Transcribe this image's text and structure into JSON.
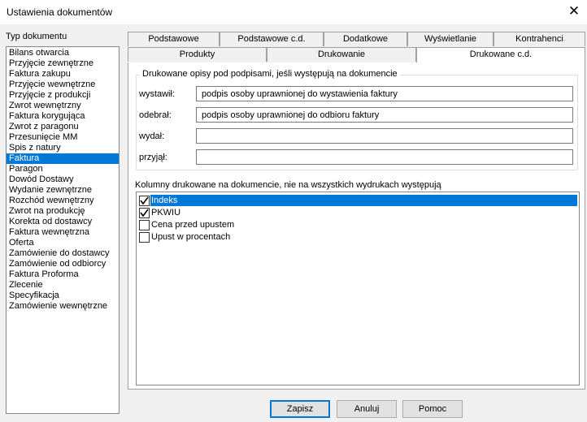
{
  "window": {
    "title": "Ustawienia dokumentów",
    "close_glyph": "✕"
  },
  "doc_types": {
    "label": "Typ dokumentu",
    "items": [
      "Bilans otwarcia",
      "Przyjęcie zewnętrzne",
      "Faktura zakupu",
      "Przyjęcie wewnętrzne",
      "Przyjęcie z produkcji",
      "Zwrot wewnętrzny",
      "Faktura korygująca",
      "Zwrot z paragonu",
      "Przesunięcie MM",
      "Spis z natury",
      "Faktura",
      "Paragon",
      "Dowód Dostawy",
      "Wydanie zewnętrzne",
      "Rozchód wewnętrzny",
      "Zwrot na produkcję",
      "Korekta od dostawcy",
      "Faktura wewnętrzna",
      "Oferta",
      "Zamówienie do dostawcy",
      "Zamówienie od odbiorcy",
      "Faktura Proforma",
      "Zlecenie",
      "Specyfikacja",
      "Zamówienie wewnętrzne"
    ],
    "selected": "Faktura"
  },
  "tabs": {
    "row1": [
      "Podstawowe",
      "Podstawowe c.d.",
      "Dodatkowe",
      "Wyświetlanie",
      "Kontrahenci"
    ],
    "row2": [
      "Produkty",
      "Drukowanie",
      "Drukowane c.d."
    ],
    "active": "Drukowane c.d."
  },
  "signatures": {
    "group_title": "Drukowane opisy pod podpisami, jeśli występują na dokumencie",
    "fields": [
      {
        "label": "wystawił:",
        "value": "podpis osoby uprawnionej do wystawienia faktury"
      },
      {
        "label": "odebrał:",
        "value": "podpis osoby uprawnionej do odbioru faktury"
      },
      {
        "label": "wydał:",
        "value": ""
      },
      {
        "label": "przyjął:",
        "value": ""
      }
    ]
  },
  "columns": {
    "label": "Kolumny drukowane na dokumencie, nie na wszystkich wydrukach występują",
    "items": [
      {
        "label": "Indeks",
        "checked": true,
        "selected": true
      },
      {
        "label": "PKWIU",
        "checked": true,
        "selected": false
      },
      {
        "label": "Cena przed upustem",
        "checked": false,
        "selected": false
      },
      {
        "label": "Upust w procentach",
        "checked": false,
        "selected": false
      }
    ]
  },
  "buttons": {
    "save": "Zapisz",
    "cancel": "Anuluj",
    "help": "Pomoc"
  },
  "colors": {
    "selection": "#0078d7",
    "default_button_border": "#0078d7"
  }
}
